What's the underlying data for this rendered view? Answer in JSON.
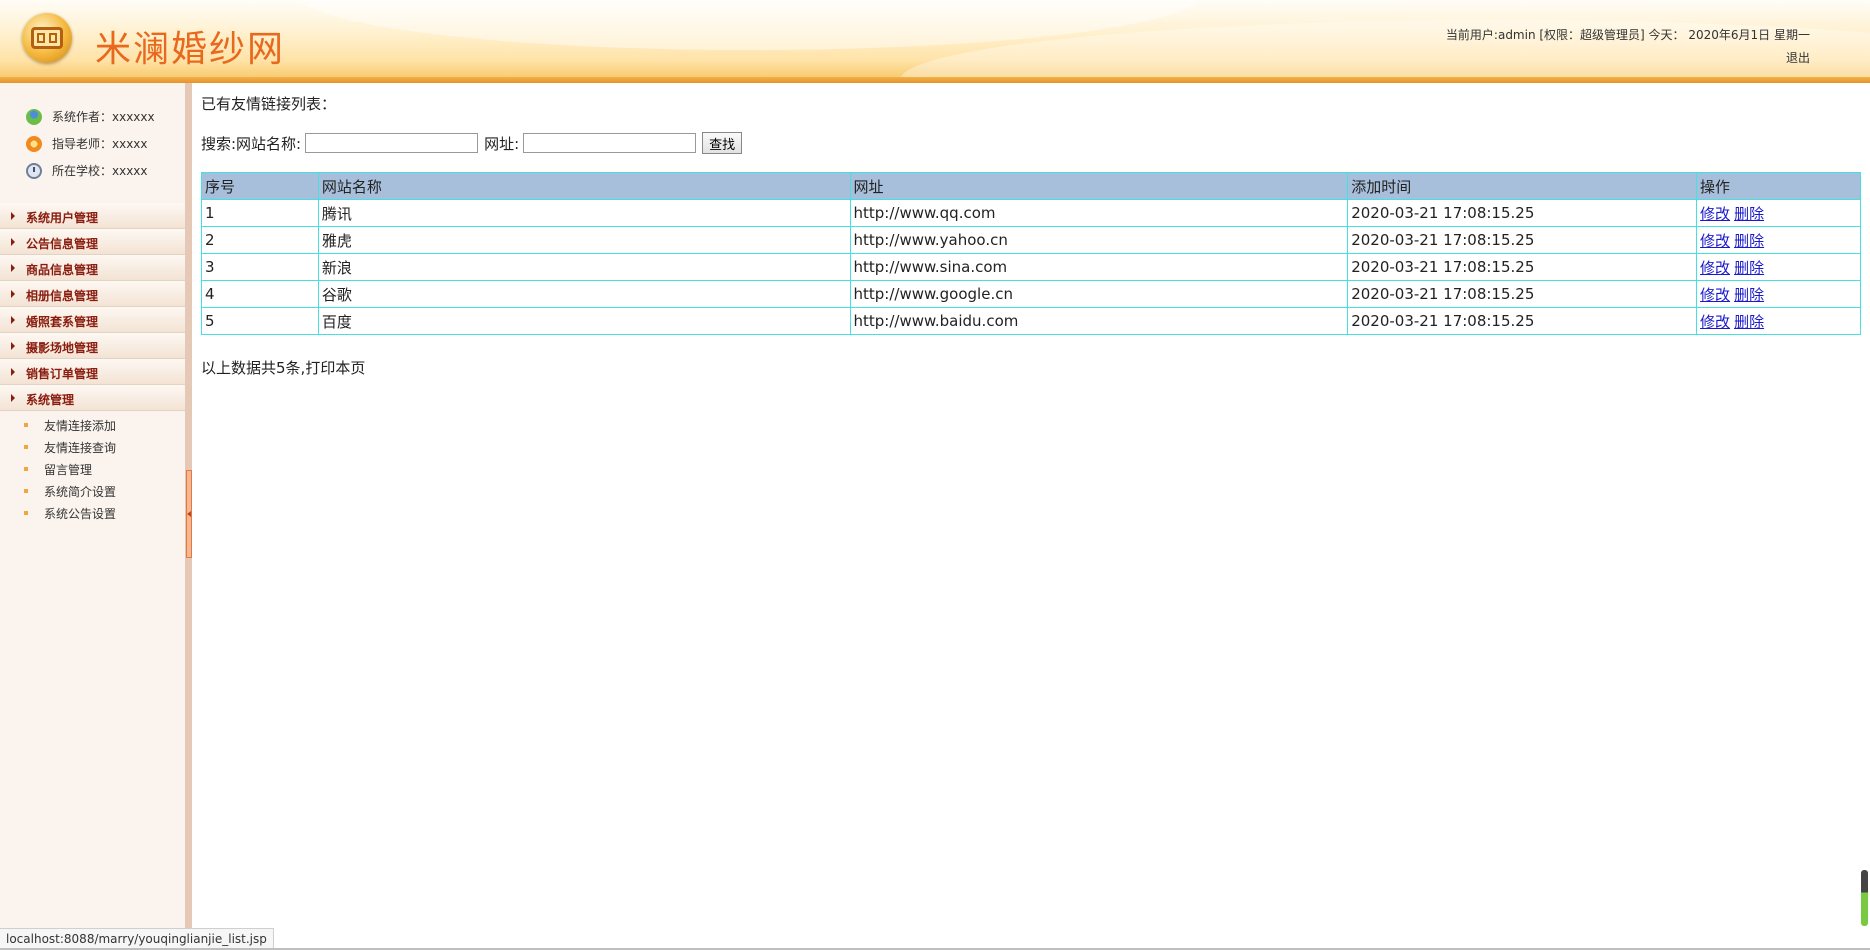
{
  "header": {
    "site_title": "米澜婚纱网",
    "user_line": "当前用户:admin [权限：超级管理员] 今天：  2020年6月1日 星期一",
    "logout_label": "退出"
  },
  "sidebar": {
    "info": [
      {
        "label": "系统作者：xxxxxx",
        "icon": "user-icon"
      },
      {
        "label": "指导老师：xxxxx",
        "icon": "teacher-icon"
      },
      {
        "label": "所在学校：xxxxx",
        "icon": "school-icon"
      }
    ],
    "menu": [
      "系统用户管理",
      "公告信息管理",
      "商品信息管理",
      "相册信息管理",
      "婚照套系管理",
      "摄影场地管理",
      "销售订单管理",
      "系统管理"
    ],
    "submenu": [
      "友情连接添加",
      "友情连接查询",
      "留言管理",
      "系统简介设置",
      "系统公告设置"
    ]
  },
  "main": {
    "list_title": "已有友情链接列表：",
    "search": {
      "name_label": "搜索:网站名称:",
      "name_value": "",
      "url_label": "网址:",
      "url_value": "",
      "button_label": "查找"
    },
    "table": {
      "headers": [
        "序号",
        "网站名称",
        "网址",
        "添加时间",
        "操作"
      ],
      "rows": [
        {
          "no": "1",
          "name": "腾讯",
          "url": "http://www.qq.com",
          "time": "2020-03-21 17:08:15.25"
        },
        {
          "no": "2",
          "name": "雅虎",
          "url": "http://www.yahoo.cn",
          "time": "2020-03-21 17:08:15.25"
        },
        {
          "no": "3",
          "name": "新浪",
          "url": "http://www.sina.com",
          "time": "2020-03-21 17:08:15.25"
        },
        {
          "no": "4",
          "name": "谷歌",
          "url": "http://www.google.cn",
          "time": "2020-03-21 17:08:15.25"
        },
        {
          "no": "5",
          "name": "百度",
          "url": "http://www.baidu.com",
          "time": "2020-03-21 17:08:15.25"
        }
      ],
      "edit_label": "修改",
      "delete_label": "删除"
    },
    "footer_text": "以上数据共5条,",
    "print_label": "打印本页"
  },
  "status_url": "localhost:8088/marry/youqinglianjie_list.jsp",
  "colors": {
    "accent": "#e8691e",
    "table_border": "#43e0e4",
    "table_header_bg": "#a7bfdb",
    "menu_text": "#8a1d0f",
    "link": "#1a1acc"
  }
}
